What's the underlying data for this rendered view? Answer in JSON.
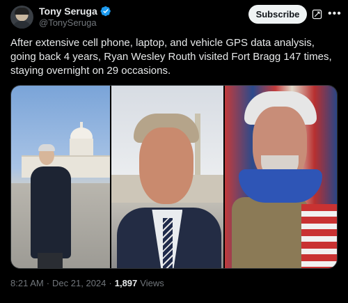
{
  "author": {
    "display_name": "Tony Seruga",
    "handle": "@TonySeruga",
    "verified": true
  },
  "actions": {
    "subscribe_label": "Subscribe"
  },
  "tweet": {
    "text": "After extensive cell phone, laptop, and vehicle GPS data analysis, going back 4 years, Ryan Wesley Routh visited Fort Bragg 147 times, staying overnight on 29 occasions."
  },
  "media": {
    "photo_count": 3
  },
  "meta": {
    "time": "8:21 AM",
    "separator": "·",
    "date": "Dec 21, 2024",
    "views_count": "1,897",
    "views_label": "Views"
  },
  "colors": {
    "background": "#000000",
    "text_primary": "#e7e9ea",
    "text_secondary": "#71767b",
    "verified_blue": "#1d9bf0",
    "button_bg": "#eff3f4"
  },
  "icons": [
    "verified-badge-icon",
    "grok-icon",
    "more-options-icon"
  ]
}
